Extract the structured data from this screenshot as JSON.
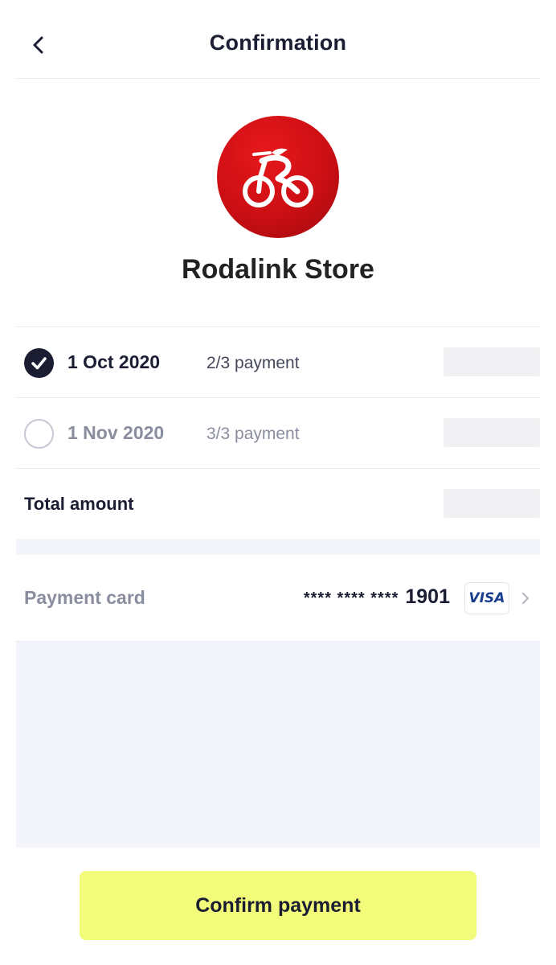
{
  "header": {
    "title": "Confirmation"
  },
  "merchant": {
    "name": "Rodalink Store",
    "logo_icon": "cyclist-logo-icon",
    "logo_color": "#d4101a"
  },
  "installments": [
    {
      "date": "1 Oct 2020",
      "label": "2/3 payment",
      "selected": true
    },
    {
      "date": "1 Nov 2020",
      "label": "3/3 payment",
      "selected": false
    }
  ],
  "total": {
    "label": "Total amount"
  },
  "payment_card": {
    "label": "Payment card",
    "masked": "**** **** ****",
    "last4": "1901",
    "brand": "VISA"
  },
  "actions": {
    "confirm_label": "Confirm payment"
  },
  "colors": {
    "accent": "#f3fb7a",
    "text": "#1b1e33",
    "muted": "#8a8d9e",
    "band": "#f4f5fb"
  }
}
